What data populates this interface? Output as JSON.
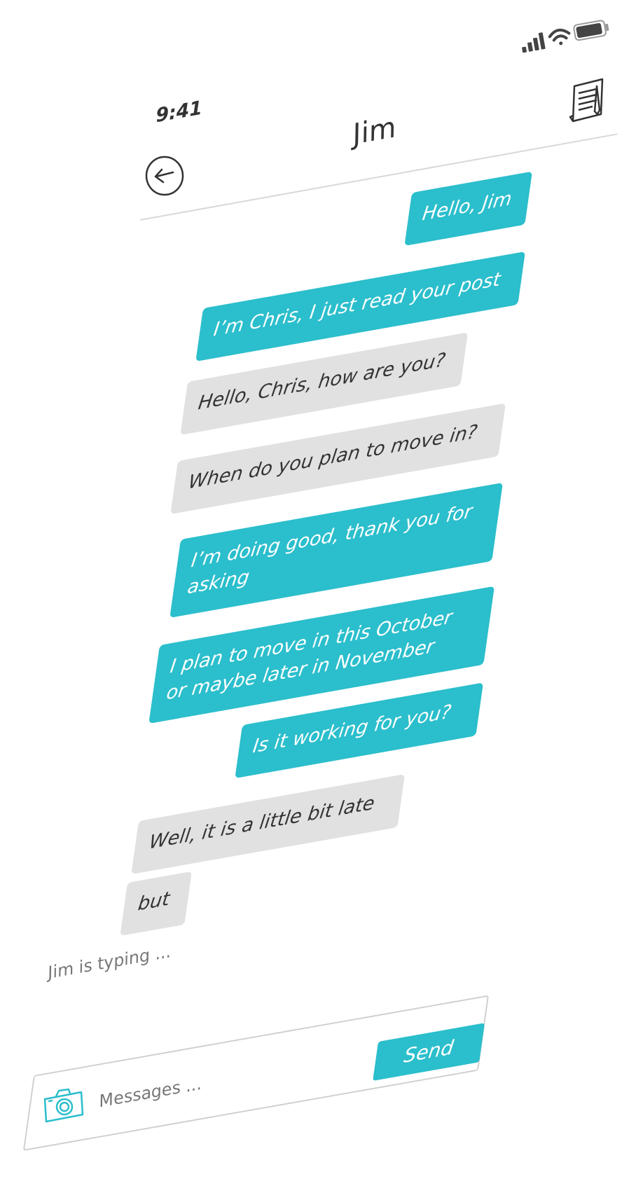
{
  "status_bar": {
    "time": "9:41",
    "icons": [
      "signal-icon",
      "wifi-icon",
      "battery-icon"
    ]
  },
  "header": {
    "title": "Jim",
    "back_icon": "arrow-left-icon",
    "notes_icon": "notes-icon"
  },
  "messages": [
    {
      "from": "me",
      "text": "Hello, Jim"
    },
    {
      "from": "me",
      "text": "I’m Chris, I just read your post"
    },
    {
      "from": "them",
      "text": "Hello, Chris, how are you?"
    },
    {
      "from": "them",
      "text": "When do you plan to move in?"
    },
    {
      "from": "me",
      "text": "I’m doing good, thank you for\nasking"
    },
    {
      "from": "me",
      "text": "I plan to move in this October\nor maybe later in November"
    },
    {
      "from": "me",
      "text": "Is it working for you?"
    },
    {
      "from": "them",
      "text": "Well, it is a little bit late"
    },
    {
      "from": "them",
      "text": "but"
    }
  ],
  "typing_indicator": "Jim is typing ...",
  "composer": {
    "placeholder": "Messages ...",
    "camera_icon": "camera-icon",
    "send_label": "Send"
  },
  "colors": {
    "accent": "#2bbecc",
    "received_bubble": "#e1e1e1",
    "text_dark": "#333333"
  }
}
